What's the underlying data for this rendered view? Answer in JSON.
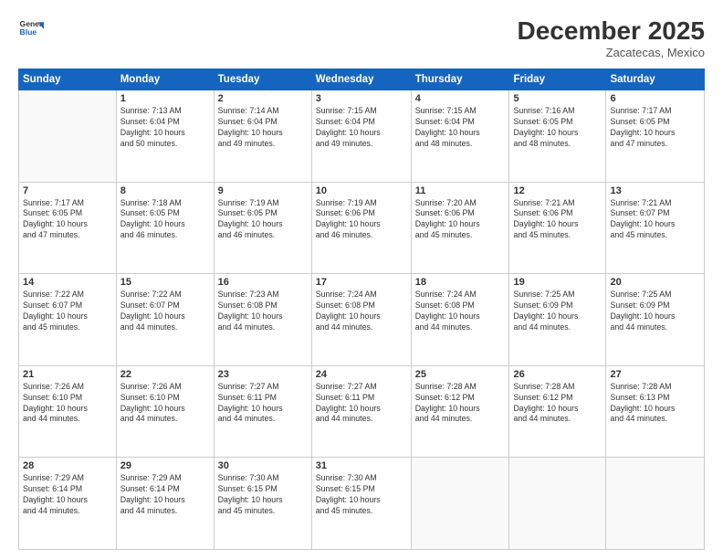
{
  "logo": {
    "line1": "General",
    "line2": "Blue"
  },
  "header": {
    "title": "December 2025",
    "location": "Zacatecas, Mexico"
  },
  "weekdays": [
    "Sunday",
    "Monday",
    "Tuesday",
    "Wednesday",
    "Thursday",
    "Friday",
    "Saturday"
  ],
  "weeks": [
    [
      {
        "day": "",
        "info": ""
      },
      {
        "day": "1",
        "info": "Sunrise: 7:13 AM\nSunset: 6:04 PM\nDaylight: 10 hours\nand 50 minutes."
      },
      {
        "day": "2",
        "info": "Sunrise: 7:14 AM\nSunset: 6:04 PM\nDaylight: 10 hours\nand 49 minutes."
      },
      {
        "day": "3",
        "info": "Sunrise: 7:15 AM\nSunset: 6:04 PM\nDaylight: 10 hours\nand 49 minutes."
      },
      {
        "day": "4",
        "info": "Sunrise: 7:15 AM\nSunset: 6:04 PM\nDaylight: 10 hours\nand 48 minutes."
      },
      {
        "day": "5",
        "info": "Sunrise: 7:16 AM\nSunset: 6:05 PM\nDaylight: 10 hours\nand 48 minutes."
      },
      {
        "day": "6",
        "info": "Sunrise: 7:17 AM\nSunset: 6:05 PM\nDaylight: 10 hours\nand 47 minutes."
      }
    ],
    [
      {
        "day": "7",
        "info": "Sunrise: 7:17 AM\nSunset: 6:05 PM\nDaylight: 10 hours\nand 47 minutes."
      },
      {
        "day": "8",
        "info": "Sunrise: 7:18 AM\nSunset: 6:05 PM\nDaylight: 10 hours\nand 46 minutes."
      },
      {
        "day": "9",
        "info": "Sunrise: 7:19 AM\nSunset: 6:05 PM\nDaylight: 10 hours\nand 46 minutes."
      },
      {
        "day": "10",
        "info": "Sunrise: 7:19 AM\nSunset: 6:06 PM\nDaylight: 10 hours\nand 46 minutes."
      },
      {
        "day": "11",
        "info": "Sunrise: 7:20 AM\nSunset: 6:06 PM\nDaylight: 10 hours\nand 45 minutes."
      },
      {
        "day": "12",
        "info": "Sunrise: 7:21 AM\nSunset: 6:06 PM\nDaylight: 10 hours\nand 45 minutes."
      },
      {
        "day": "13",
        "info": "Sunrise: 7:21 AM\nSunset: 6:07 PM\nDaylight: 10 hours\nand 45 minutes."
      }
    ],
    [
      {
        "day": "14",
        "info": "Sunrise: 7:22 AM\nSunset: 6:07 PM\nDaylight: 10 hours\nand 45 minutes."
      },
      {
        "day": "15",
        "info": "Sunrise: 7:22 AM\nSunset: 6:07 PM\nDaylight: 10 hours\nand 44 minutes."
      },
      {
        "day": "16",
        "info": "Sunrise: 7:23 AM\nSunset: 6:08 PM\nDaylight: 10 hours\nand 44 minutes."
      },
      {
        "day": "17",
        "info": "Sunrise: 7:24 AM\nSunset: 6:08 PM\nDaylight: 10 hours\nand 44 minutes."
      },
      {
        "day": "18",
        "info": "Sunrise: 7:24 AM\nSunset: 6:08 PM\nDaylight: 10 hours\nand 44 minutes."
      },
      {
        "day": "19",
        "info": "Sunrise: 7:25 AM\nSunset: 6:09 PM\nDaylight: 10 hours\nand 44 minutes."
      },
      {
        "day": "20",
        "info": "Sunrise: 7:25 AM\nSunset: 6:09 PM\nDaylight: 10 hours\nand 44 minutes."
      }
    ],
    [
      {
        "day": "21",
        "info": "Sunrise: 7:26 AM\nSunset: 6:10 PM\nDaylight: 10 hours\nand 44 minutes."
      },
      {
        "day": "22",
        "info": "Sunrise: 7:26 AM\nSunset: 6:10 PM\nDaylight: 10 hours\nand 44 minutes."
      },
      {
        "day": "23",
        "info": "Sunrise: 7:27 AM\nSunset: 6:11 PM\nDaylight: 10 hours\nand 44 minutes."
      },
      {
        "day": "24",
        "info": "Sunrise: 7:27 AM\nSunset: 6:11 PM\nDaylight: 10 hours\nand 44 minutes."
      },
      {
        "day": "25",
        "info": "Sunrise: 7:28 AM\nSunset: 6:12 PM\nDaylight: 10 hours\nand 44 minutes."
      },
      {
        "day": "26",
        "info": "Sunrise: 7:28 AM\nSunset: 6:12 PM\nDaylight: 10 hours\nand 44 minutes."
      },
      {
        "day": "27",
        "info": "Sunrise: 7:28 AM\nSunset: 6:13 PM\nDaylight: 10 hours\nand 44 minutes."
      }
    ],
    [
      {
        "day": "28",
        "info": "Sunrise: 7:29 AM\nSunset: 6:14 PM\nDaylight: 10 hours\nand 44 minutes."
      },
      {
        "day": "29",
        "info": "Sunrise: 7:29 AM\nSunset: 6:14 PM\nDaylight: 10 hours\nand 44 minutes."
      },
      {
        "day": "30",
        "info": "Sunrise: 7:30 AM\nSunset: 6:15 PM\nDaylight: 10 hours\nand 45 minutes."
      },
      {
        "day": "31",
        "info": "Sunrise: 7:30 AM\nSunset: 6:15 PM\nDaylight: 10 hours\nand 45 minutes."
      },
      {
        "day": "",
        "info": ""
      },
      {
        "day": "",
        "info": ""
      },
      {
        "day": "",
        "info": ""
      }
    ]
  ]
}
